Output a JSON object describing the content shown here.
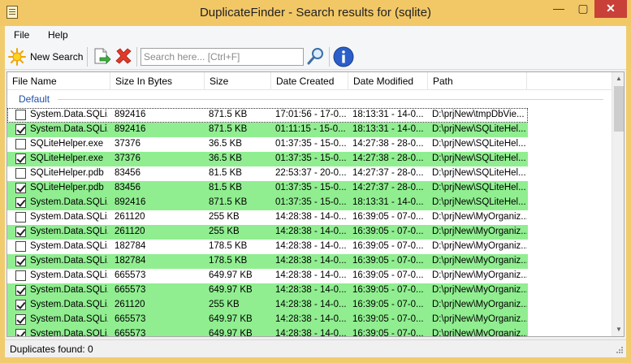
{
  "window": {
    "title": "DuplicateFinder - Search results for (sqlite)",
    "minimize": "—",
    "maximize": "▢",
    "close": "✕"
  },
  "menu": {
    "file": "File",
    "help": "Help"
  },
  "toolbar": {
    "new_search_label": "New Search",
    "search_placeholder": "Search here... [Ctrl+F]",
    "search_value": ""
  },
  "list": {
    "columns": [
      "File Name",
      "Size In Bytes",
      "Size",
      "Date Created",
      "Date Modified",
      "Path"
    ],
    "group": "Default",
    "rows": [
      {
        "checked": false,
        "name": "System.Data.SQLi...",
        "bytes": "892416",
        "size": "871.5 KB",
        "created": "17:01:56 - 17-0...",
        "modified": "18:13:31 - 14-0...",
        "path": "D:\\prjNew\\tmpDbVie..."
      },
      {
        "checked": true,
        "name": "System.Data.SQLi...",
        "bytes": "892416",
        "size": "871.5 KB",
        "created": "01:11:15 - 15-0...",
        "modified": "18:13:31 - 14-0...",
        "path": "D:\\prjNew\\SQLiteHel..."
      },
      {
        "checked": false,
        "name": "SQLiteHelper.exe",
        "bytes": "37376",
        "size": "36.5 KB",
        "created": "01:37:35 - 15-0...",
        "modified": "14:27:38 - 28-0...",
        "path": "D:\\prjNew\\SQLiteHel..."
      },
      {
        "checked": true,
        "name": "SQLiteHelper.exe",
        "bytes": "37376",
        "size": "36.5 KB",
        "created": "01:37:35 - 15-0...",
        "modified": "14:27:38 - 28-0...",
        "path": "D:\\prjNew\\SQLiteHel..."
      },
      {
        "checked": false,
        "name": "SQLiteHelper.pdb",
        "bytes": "83456",
        "size": "81.5 KB",
        "created": "22:53:37 - 20-0...",
        "modified": "14:27:37 - 28-0...",
        "path": "D:\\prjNew\\SQLiteHel..."
      },
      {
        "checked": true,
        "name": "SQLiteHelper.pdb",
        "bytes": "83456",
        "size": "81.5 KB",
        "created": "01:37:35 - 15-0...",
        "modified": "14:27:37 - 28-0...",
        "path": "D:\\prjNew\\SQLiteHel..."
      },
      {
        "checked": true,
        "name": "System.Data.SQLi...",
        "bytes": "892416",
        "size": "871.5 KB",
        "created": "01:37:35 - 15-0...",
        "modified": "18:13:31 - 14-0...",
        "path": "D:\\prjNew\\SQLiteHel..."
      },
      {
        "checked": false,
        "name": "System.Data.SQLi...",
        "bytes": "261120",
        "size": "255 KB",
        "created": "14:28:38 - 14-0...",
        "modified": "16:39:05 - 07-0...",
        "path": "D:\\prjNew\\MyOrganiz..."
      },
      {
        "checked": true,
        "name": "System.Data.SQLi...",
        "bytes": "261120",
        "size": "255 KB",
        "created": "14:28:38 - 14-0...",
        "modified": "16:39:05 - 07-0...",
        "path": "D:\\prjNew\\MyOrganiz..."
      },
      {
        "checked": false,
        "name": "System.Data.SQLi...",
        "bytes": "182784",
        "size": "178.5 KB",
        "created": "14:28:38 - 14-0...",
        "modified": "16:39:05 - 07-0...",
        "path": "D:\\prjNew\\MyOrganiz..."
      },
      {
        "checked": true,
        "name": "System.Data.SQLi...",
        "bytes": "182784",
        "size": "178.5 KB",
        "created": "14:28:38 - 14-0...",
        "modified": "16:39:05 - 07-0...",
        "path": "D:\\prjNew\\MyOrganiz..."
      },
      {
        "checked": false,
        "name": "System.Data.SQLi...",
        "bytes": "665573",
        "size": "649.97 KB",
        "created": "14:28:38 - 14-0...",
        "modified": "16:39:05 - 07-0...",
        "path": "D:\\prjNew\\MyOrganiz..."
      },
      {
        "checked": true,
        "name": "System.Data.SQLi...",
        "bytes": "665573",
        "size": "649.97 KB",
        "created": "14:28:38 - 14-0...",
        "modified": "16:39:05 - 07-0...",
        "path": "D:\\prjNew\\MyOrganiz..."
      },
      {
        "checked": true,
        "name": "System.Data.SQLi...",
        "bytes": "261120",
        "size": "255 KB",
        "created": "14:28:38 - 14-0...",
        "modified": "16:39:05 - 07-0...",
        "path": "D:\\prjNew\\MyOrganiz..."
      },
      {
        "checked": true,
        "name": "System.Data.SQLi...",
        "bytes": "665573",
        "size": "649.97 KB",
        "created": "14:28:38 - 14-0...",
        "modified": "16:39:05 - 07-0...",
        "path": "D:\\prjNew\\MyOrganiz..."
      },
      {
        "checked": true,
        "name": "System.Data.SQLi...",
        "bytes": "665573",
        "size": "649.97 KB",
        "created": "14:28:38 - 14-0...",
        "modified": "16:39:05 - 07-0...",
        "path": "D:\\prjNew\\MyOrganiz..."
      }
    ]
  },
  "status": {
    "text": "Duplicates found: 0"
  },
  "colors": {
    "checked_row": "#90ee90",
    "title_bar": "#f2c766",
    "close_button": "#c84038",
    "group_label": "#1e4fa8"
  },
  "icons": [
    "app-icon",
    "sun-icon",
    "export-icon",
    "delete-icon",
    "magnifier-icon",
    "info-icon",
    "resize-grip-icon"
  ]
}
